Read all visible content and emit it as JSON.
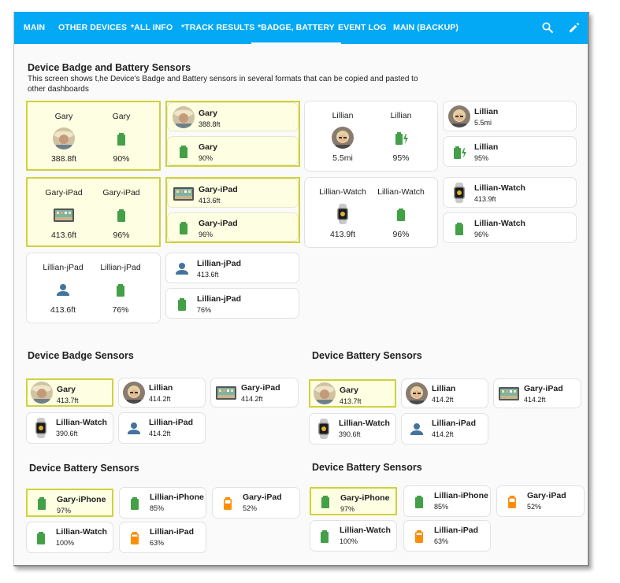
{
  "tabs": [
    {
      "label": "MAIN"
    },
    {
      "label": "OTHER DEVICES"
    },
    {
      "label": "*ALL INFO"
    },
    {
      "label": "*TRACK RESULTS"
    },
    {
      "label": "*BADGE, BATTERY"
    },
    {
      "label": "EVENT LOG"
    },
    {
      "label": "MAIN (BACKUP)"
    }
  ],
  "top_icons": [
    "search-icon",
    "pencil-icon"
  ],
  "section_main": {
    "title": "Device Badge and Battery Sensors",
    "desc1": "This screen shows t,he Device's Badge and Battery sensors in several formats that can be copied and pasted to",
    "desc2": "other dashboards"
  },
  "grid_cards": [
    {
      "badge": "Gary",
      "badge_val": "388.8ft",
      "battery": "Gary",
      "battery_val": "90%"
    },
    {
      "badge": "Lillian",
      "badge_val": "5.5mi",
      "battery": "Lillian",
      "battery_val": "95%"
    },
    {
      "badge": "Gary-iPad",
      "badge_val": "413.6ft",
      "battery": "Gary-iPad",
      "battery_val": "96%"
    },
    {
      "badge": "Lillian-Watch",
      "badge_val": "413.9ft",
      "battery": "Lillian-Watch",
      "battery_val": "96%"
    },
    {
      "badge": "Lillian-jPad",
      "badge_val": "413.6ft",
      "battery": "Lillian-jPad",
      "battery_val": "76%"
    }
  ],
  "entity_cards": [
    {
      "name": "Gary",
      "value": "388.8ft"
    },
    {
      "name": "Gary",
      "value": "90%"
    },
    {
      "name": "Gary-iPad",
      "value": "413.6ft"
    },
    {
      "name": "Gary-iPad",
      "value": "96%"
    },
    {
      "name": "Lillian-jPad",
      "value": "413.6ft"
    },
    {
      "name": "Lillian-jPad",
      "value": "76%"
    },
    {
      "name": "Lillian",
      "value": "5.5mi"
    },
    {
      "name": "Lillian",
      "value": "95%"
    },
    {
      "name": "Lillian-Watch",
      "value": "413.9ft"
    },
    {
      "name": "Lillian-Watch",
      "value": "96%"
    }
  ],
  "badge_section": {
    "title": "Device Badge Sensors",
    "items": [
      {
        "name": "Gary",
        "value": "413.7ft"
      },
      {
        "name": "Lillian",
        "value": "414.2ft"
      },
      {
        "name": "Gary-iPad",
        "value": "414.2ft"
      },
      {
        "name": "Lillian-Watch",
        "value": "390.6ft"
      },
      {
        "name": "Lillian-iPad",
        "value": "414.2ft"
      }
    ]
  },
  "badge_section_2": {
    "title": "Device Battery Sensors",
    "items": [
      {
        "name": "Gary",
        "value": "413.7ft"
      },
      {
        "name": "Lillian",
        "value": "414.2ft"
      },
      {
        "name": "Gary-iPad",
        "value": "414.2ft"
      },
      {
        "name": "Lillian-Watch",
        "value": "390.6ft"
      },
      {
        "name": "Lillian-iPad",
        "value": "414.2ft"
      }
    ]
  },
  "battery_section_left": {
    "title": "Device Battery Sensors",
    "items": [
      {
        "name": "Gary-iPhone",
        "value": "97%"
      },
      {
        "name": "Lillian-iPhone",
        "value": "85%"
      },
      {
        "name": "Gary-iPad",
        "value": "52%"
      },
      {
        "name": "Lillian-Watch",
        "value": "100%"
      },
      {
        "name": "Lillian-iPad",
        "value": "63%"
      }
    ]
  },
  "battery_section_right": {
    "title": "Device Battery Sensors",
    "items": [
      {
        "name": "Gary-iPhone",
        "value": "97%"
      },
      {
        "name": "Lillian-iPhone",
        "value": "85%"
      },
      {
        "name": "Gary-iPad",
        "value": "52%"
      },
      {
        "name": "Lillian-Watch",
        "value": "100%"
      },
      {
        "name": "Lillian-iPad",
        "value": "63%"
      }
    ]
  },
  "colors": {
    "header": "#03a9f4",
    "highlight_border": "#cfd23c",
    "highlight_fill": "#fefee2",
    "battery_green": "#43a047",
    "battery_orange": "#fb8c00",
    "person_blue": "#44739e"
  }
}
